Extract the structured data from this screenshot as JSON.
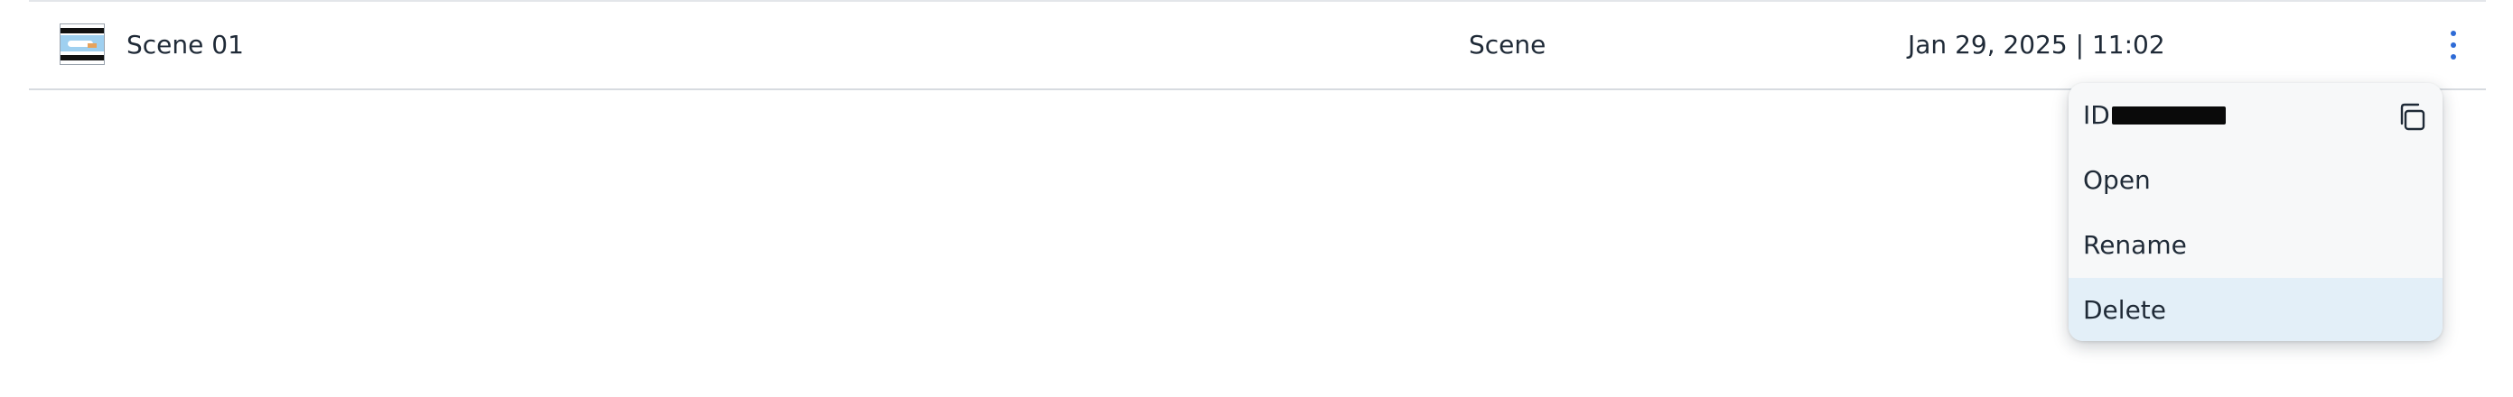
{
  "row": {
    "name": "Scene 01",
    "type": "Scene",
    "date": "Jan 29, 2025 | 11:02"
  },
  "menu": {
    "id_label": "ID",
    "open_label": "Open",
    "rename_label": "Rename",
    "delete_label": "Delete",
    "copy_icon": "copy-icon",
    "more_icon": "more-vertical-icon"
  },
  "colors": {
    "accent": "#2e6bd6",
    "highlight": "#e3eff8",
    "text": "#1f2a37"
  }
}
